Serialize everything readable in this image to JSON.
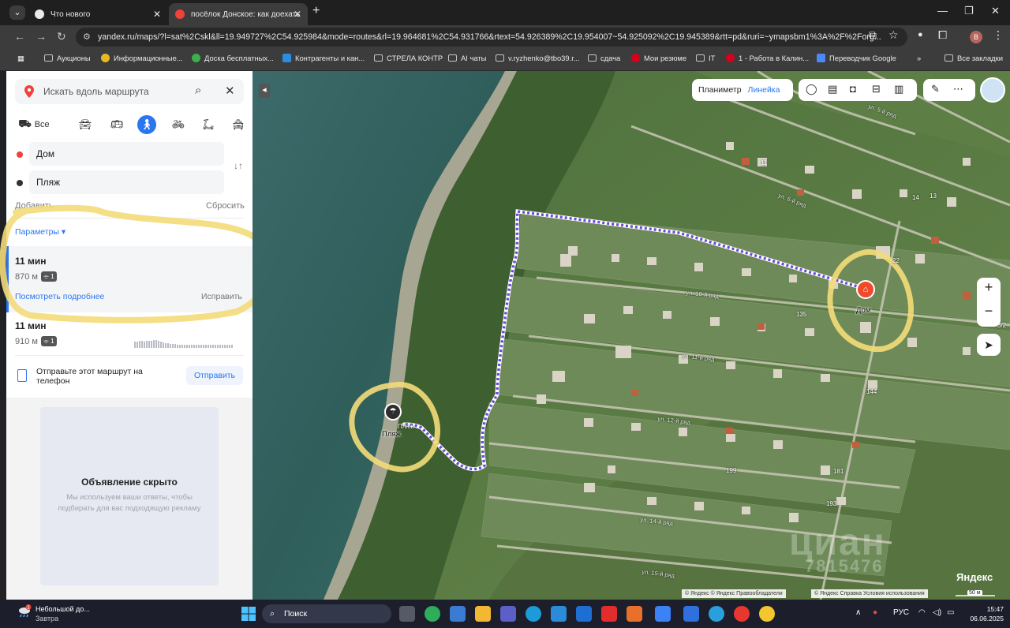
{
  "browser": {
    "tabs": [
      {
        "title": "Что нового",
        "icon": "chrome-icon"
      },
      {
        "title": "посёлок Донское: как доехать",
        "icon": "yandex-maps-pin-icon"
      }
    ],
    "url": "yandex.ru/maps/?l=sat%2Cskl&ll=19.949727%2C54.925984&mode=routes&rl=19.964681%2C54.931766&rtext=54.926389%2C19.954007~54.925092%2C19.945389&rtt=pd&ruri=~ymapsbm1%3A%2F%2Forg...",
    "profile_letter": "В",
    "bookmarks": [
      {
        "label": "Аукционы",
        "icon": "folder-icon"
      },
      {
        "label": "Информационные...",
        "icon": "crown-icon"
      },
      {
        "label": "Доска бесплатных...",
        "icon": "board-icon"
      },
      {
        "label": "Контрагенты и кан...",
        "icon": "square-icon"
      },
      {
        "label": "СТРЕЛА КОНТР",
        "icon": "folder-icon"
      },
      {
        "label": "AI чаты",
        "icon": "folder-icon"
      },
      {
        "label": "v.ryzhenko@tbo39.r...",
        "icon": "mail-icon"
      },
      {
        "label": "сдача",
        "icon": "folder-icon"
      },
      {
        "label": "Мои резюме",
        "icon": "hh-icon"
      },
      {
        "label": "IT",
        "icon": "folder-icon"
      },
      {
        "label": "1 - Работа в Калин...",
        "icon": "hh-icon"
      },
      {
        "label": "Переводчик Google",
        "icon": "translate-icon"
      }
    ],
    "bookmarks_all": "Все закладки"
  },
  "panel": {
    "search_placeholder": "Искать вдоль маршрута",
    "mode_all": "Все",
    "from": "Дом",
    "to": "Пляж",
    "add": "Добавить",
    "reset": "Сбросить",
    "params": "Параметры ▾",
    "routes": [
      {
        "time": "11 мин",
        "distance": "870 м",
        "stairs": "1",
        "details": "Посмотреть подробнее",
        "fix": "Исправить"
      },
      {
        "time": "11 мин",
        "distance": "910 м",
        "stairs": "1"
      }
    ],
    "send_text": "Отправьте этот маршрут на телефон",
    "send_button": "Отправить",
    "ad_title": "Объявление скрыто",
    "ad_text": "Мы используем ваши ответы, чтобы подбирать для вас подходящую рекламу"
  },
  "map": {
    "tool_planimeter": "Планиметр",
    "tool_ruler": "Линейка",
    "home_label": "Дом",
    "beach_label": "Пляж",
    "beach_label_small": "Пляж",
    "house_numbers": [
      "11",
      "13",
      "14",
      "22",
      "135",
      "144",
      "199",
      "181",
      "193",
      "3/2"
    ],
    "streets": [
      "ул. 5-й ряд",
      "ул. 6-й ряд",
      "ул. 10-й ряд",
      "ул. 11-й ряд",
      "ул. 12-й ряд",
      "ул. 14-й ряд",
      "ул. 15-й ряд"
    ],
    "watermark_big": "циан",
    "watermark_num": "7815476",
    "logo": "Яндекс",
    "attrib_left": "© Яндекс © Яндекс  Правообладатели",
    "attrib_right": "© Яндекс  Справка  Условия использования",
    "scale": "50 м"
  },
  "taskbar": {
    "weather_title": "Небольшой до...",
    "weather_sub": "Завтра",
    "weather_badge": "1",
    "search": "Поиск",
    "lang": "РУС",
    "time": "15:47",
    "date": "06.06.2025"
  }
}
